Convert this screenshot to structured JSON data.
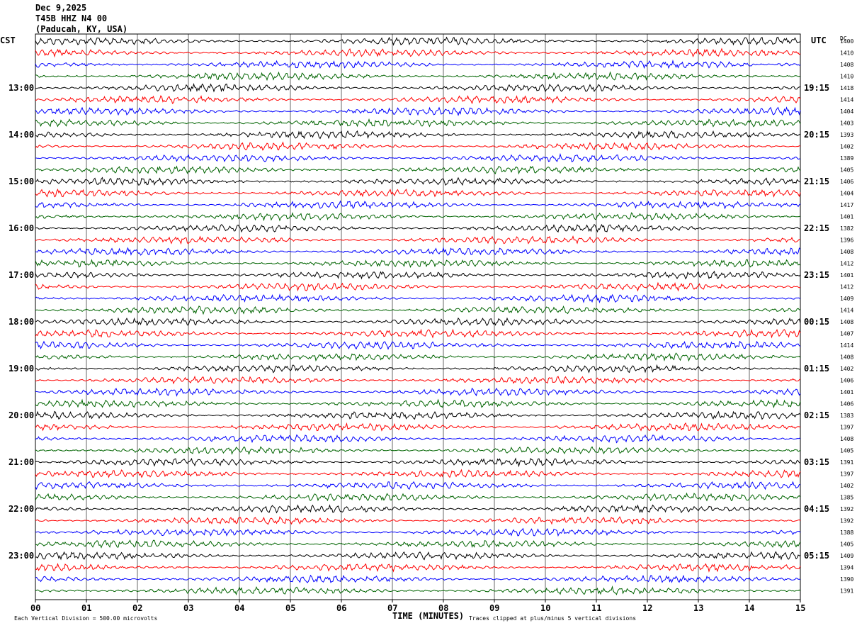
{
  "header": {
    "date": "Dec 9,2025",
    "station": "T45B HHZ N4 00",
    "location": "(Paducah, KY, USA)"
  },
  "left_axis_label": "CST",
  "right_axis_label": "UTC",
  "dc_label": "DC",
  "footer": {
    "scale_note": "Each Vertical Division =  500.00 microvolts",
    "clip_note": "Traces clipped at plus/minus 5 vertical divisions"
  },
  "colors": [
    "#000000",
    "#ff0000",
    "#0000ff",
    "#006400"
  ],
  "chart_data": {
    "type": "line",
    "title": "Dec 9,2025 T45B HHZ N4 00 (Paducah, KY, USA)",
    "xlabel": "TIME (MINUTES)",
    "ylabel": "",
    "xlim": [
      0,
      15
    ],
    "x_ticks": [
      "00",
      "01",
      "02",
      "03",
      "04",
      "05",
      "06",
      "07",
      "08",
      "09",
      "10",
      "11",
      "12",
      "13",
      "14",
      "15"
    ],
    "left_time_labels": [
      "13:00",
      "14:00",
      "15:00",
      "16:00",
      "17:00",
      "18:00",
      "19:00",
      "20:00",
      "21:00",
      "22:00",
      "23:00"
    ],
    "right_time_labels": [
      "19:15",
      "20:15",
      "21:15",
      "22:15",
      "23:15",
      "00:15",
      "01:15",
      "02:15",
      "03:15",
      "04:15",
      "05:15"
    ],
    "dc_offsets": [
      1400,
      1410,
      1408,
      1410,
      1418,
      1414,
      1404,
      1403,
      1393,
      1402,
      1389,
      1405,
      1406,
      1404,
      1417,
      1401,
      1382,
      1396,
      1408,
      1412,
      1401,
      1412,
      1409,
      1414,
      1408,
      1407,
      1414,
      1408,
      1402,
      1406,
      1401,
      1406,
      1383,
      1397,
      1408,
      1405,
      1391,
      1397,
      1402,
      1385,
      1392,
      1392,
      1388,
      1405,
      1409,
      1394,
      1390,
      1391
    ],
    "trace_count": 48,
    "minutes_per_trace": 15,
    "grid": "vertical lines each minute"
  }
}
